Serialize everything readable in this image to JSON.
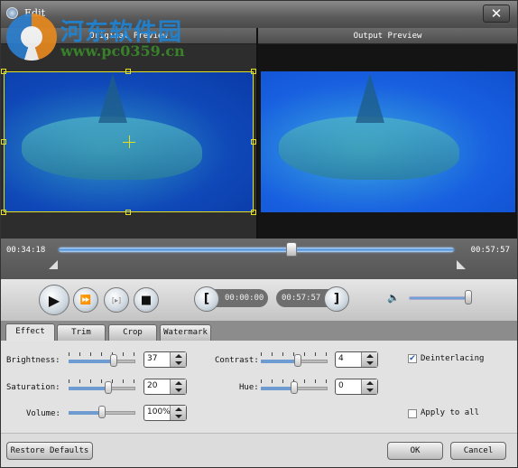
{
  "window": {
    "title": "Edit",
    "close_label": "✕"
  },
  "watermark": {
    "cn_text": "河东软件园",
    "url": "www.pc0359.cn"
  },
  "preview": {
    "original_label": "Original Preview",
    "output_label": "Output Preview"
  },
  "timeline": {
    "current_time": "00:34:18",
    "total_time": "00:57:57",
    "position_fraction": 0.59
  },
  "controls": {
    "play_icon": "▶",
    "fast_forward_icon": "⏩",
    "frame_icon": "[▸]",
    "stop_icon": "■",
    "mark_in_icon": "[",
    "mark_out_icon": "]",
    "start_time": "00:00:00",
    "end_time": "00:57:57",
    "volume_icon": "🔈",
    "volume_fraction": 1.0
  },
  "tabs": [
    {
      "label": "Effect",
      "active": true
    },
    {
      "label": "Trim",
      "active": false
    },
    {
      "label": "Crop",
      "active": false
    },
    {
      "label": "Watermark",
      "active": false
    }
  ],
  "effect": {
    "brightness": {
      "label": "Brightness:",
      "value": "37",
      "fraction": 0.68
    },
    "saturation": {
      "label": "Saturation:",
      "value": "20",
      "fraction": 0.6
    },
    "volume": {
      "label": "Volume:",
      "value": "100%",
      "fraction": 0.5
    },
    "contrast": {
      "label": "Contrast:",
      "value": "4",
      "fraction": 0.56
    },
    "hue": {
      "label": "Hue:",
      "value": "0",
      "fraction": 0.5
    },
    "deinterlacing": {
      "label": "Deinterlacing",
      "checked": true,
      "mark": "✔"
    },
    "apply_to_all": {
      "label": "Apply to all",
      "checked": false
    }
  },
  "footer": {
    "restore_label": "Restore Defaults",
    "ok_label": "OK",
    "cancel_label": "Cancel"
  }
}
